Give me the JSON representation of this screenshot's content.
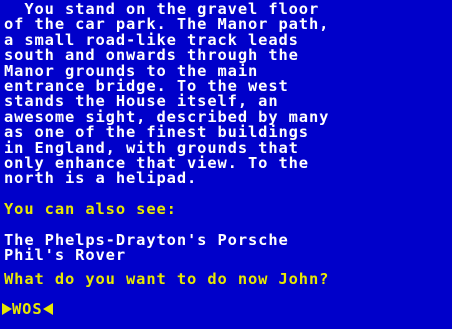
{
  "description": [
    "  You stand on the gravel floor",
    "of the car park. The Manor path,",
    "a small road-like track leads",
    "south and onwards through the",
    "Manor grounds to the main",
    "entrance bridge. To the west",
    "stands the House itself, an",
    "awesome sight, described by many",
    "as one of the finest buildings",
    "in England, with grounds that",
    "only enhance that view. To the",
    "north is a helipad."
  ],
  "also_see_heading": "You can also see:",
  "items": [
    "The Phelps-Drayton's Porsche",
    "Phil's Rover"
  ],
  "question": "What do you want to do now John?",
  "command_input": "WOS",
  "colors": {
    "background": "#0000ca",
    "description_text": "#ffffff",
    "highlight_text": "#e8e800",
    "border": "#ffffff"
  },
  "icons": {
    "prompt_start": "right-pointing-triangle",
    "cursor": "left-pointing-triangle"
  }
}
